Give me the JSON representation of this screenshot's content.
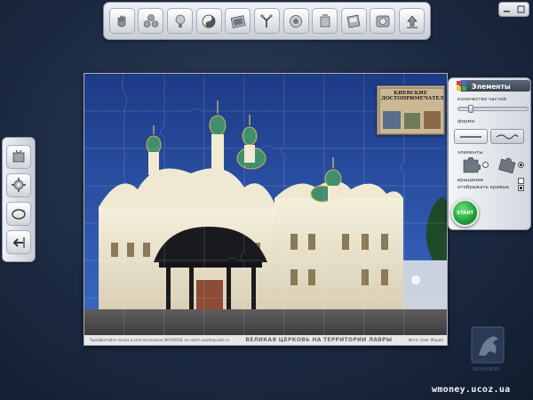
{
  "toolbar": {
    "buttons": [
      {
        "icon": "hand-pieces-icon"
      },
      {
        "icon": "group-pieces-icon"
      },
      {
        "icon": "lamp-hint-icon"
      },
      {
        "icon": "yin-yang-icon"
      },
      {
        "icon": "photo-frame-icon"
      },
      {
        "icon": "scatter-pieces-icon"
      },
      {
        "icon": "ghost-image-icon"
      },
      {
        "icon": "fullscreen-icon"
      },
      {
        "icon": "save-icon"
      },
      {
        "icon": "settings-icon"
      },
      {
        "icon": "upload-icon"
      }
    ]
  },
  "left_toolbar": {
    "buttons": [
      {
        "icon": "puzzle-box-icon"
      },
      {
        "icon": "gear-pieces-icon"
      },
      {
        "icon": "rotate-icon"
      },
      {
        "icon": "exit-arrow-icon"
      }
    ]
  },
  "puzzle": {
    "caption_left": "Приобретайте пазлы в сети магазинов SKYHORSE на сайте pazzlepuzzle.ru",
    "caption_main": "ВЕЛИКАЯ ЦЕРКОВЬ НА ТЕРРИТОРИИ ЛАВРЫ",
    "caption_right": "Фото: Олег Жарий",
    "thumbnail_text": "КИЕВСКИЕ ДОСТОПРИМЕЧАТЕЛЬНОСТИ"
  },
  "elements_panel": {
    "title": "Элементы",
    "pieces_count_label": "количество частей",
    "pieces_slider_value": 0.15,
    "shape_label": "форма",
    "elements_label": "элементы",
    "rotation_label": "вращение",
    "curves_label": "отображать кривые",
    "start_label": "START"
  },
  "branding": {
    "logo_text": "SKYHORSE",
    "watermark": "wmoney.ucoz.ua"
  },
  "colors": {
    "background": "#1c2a42",
    "start_green": "#1c9e34",
    "panel": "#d3d8df"
  }
}
